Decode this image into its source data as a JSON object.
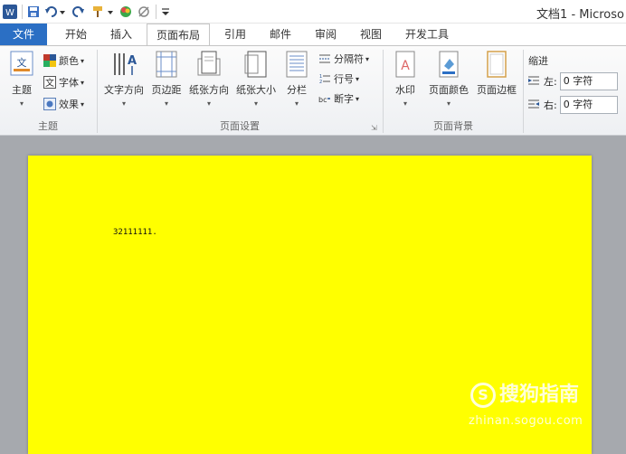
{
  "title_bar": {
    "doc_title": "文档1 - Microso",
    "app_icon": "word-app-icon",
    "quick_access": [
      "save-icon",
      "undo-icon",
      "redo-icon",
      "format-painter-icon",
      "color-icon",
      "clear-format-icon",
      "customize-dropdown-icon"
    ]
  },
  "tabs": [
    {
      "label": "文件"
    },
    {
      "label": "开始"
    },
    {
      "label": "插入"
    },
    {
      "label": "页面布局"
    },
    {
      "label": "引用"
    },
    {
      "label": "邮件"
    },
    {
      "label": "审阅"
    },
    {
      "label": "视图"
    },
    {
      "label": "开发工具"
    }
  ],
  "active_tab": "页面布局",
  "ribbon": {
    "theme_group": {
      "label": "主题",
      "big_button": "主题",
      "small_buttons": [
        "颜色",
        "字体",
        "效果"
      ]
    },
    "page_setup_group": {
      "label": "页面设置",
      "big_buttons": [
        "文字方向",
        "页边距",
        "纸张方向",
        "纸张大小",
        "分栏"
      ],
      "small_buttons": [
        "分隔符",
        "行号",
        "断字"
      ]
    },
    "page_background_group": {
      "label": "页面背景",
      "big_buttons": [
        "水印",
        "页面颜色",
        "页面边框"
      ]
    },
    "indent_group": {
      "label": "缩进",
      "left_label": "左:",
      "left_value": "0 字符",
      "right_label": "右:",
      "right_value": "0 字符"
    }
  },
  "document": {
    "page_color": "#ffff00",
    "text": "32111111."
  },
  "watermark": {
    "brand": "搜狗指南",
    "url": "zhinan.sogou.com"
  },
  "colors": {
    "file_tab": "#2b6fc4",
    "doc_background": "#a6a9ae",
    "page": "#ffff00"
  }
}
